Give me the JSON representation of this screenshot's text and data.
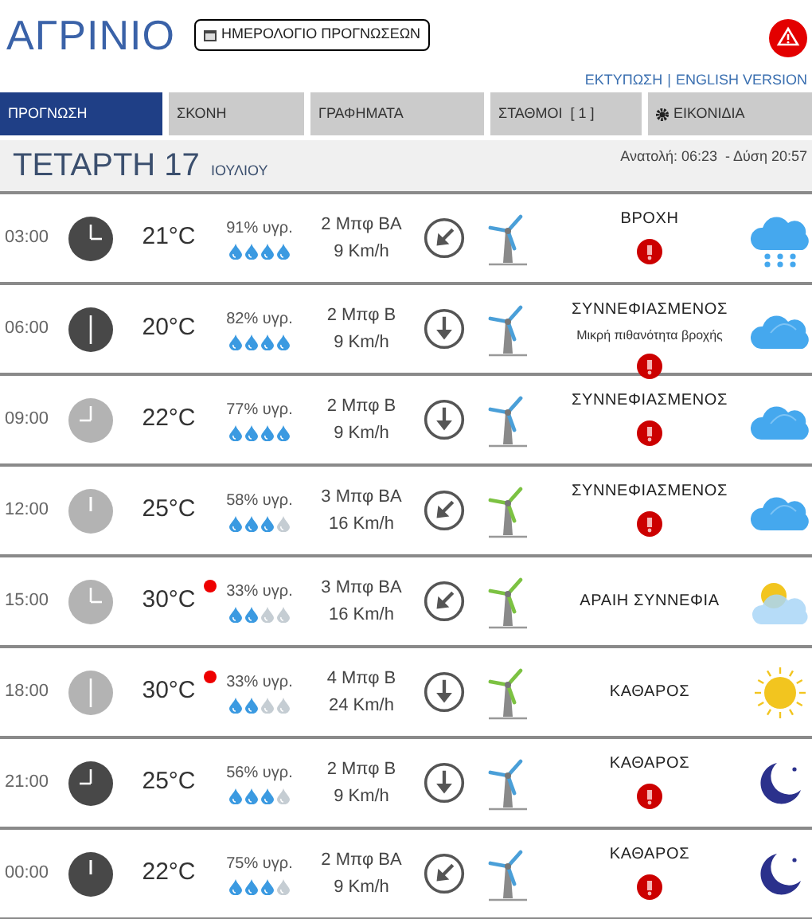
{
  "header": {
    "city": "ΑΓΡΙΝΙΟ",
    "calendar_button": "ΗΜΕΡΟΛΟΓΙΟ ΠΡΟΓΝΩΣΕΩΝ",
    "alert": true,
    "links": [
      "ΕΚΤΥΠΩΣΗ",
      "ENGLISH VERSION"
    ],
    "link_separator": "|"
  },
  "tabs": [
    {
      "label": "ΠΡΟΓΝΩΣΗ",
      "selected": true
    },
    {
      "label": "ΣΚΟΝΗ",
      "selected": false
    },
    {
      "label": "ΓΡΑΦΗΜΑΤΑ",
      "selected": false
    },
    {
      "label": "ΣΤΑΘΜΟΙ  [ 1 ]",
      "selected": false
    },
    {
      "label": "ΕΙΚΟΝΙΔΙΑ",
      "selected": false,
      "kind": "gear"
    }
  ],
  "day": {
    "weekday": "ΤΕΤΑΡΤΗ 17",
    "month": "ΙΟΥΛΙΟΥ",
    "sun": "Ανατολή: 06:23  - Δύση 20:57"
  },
  "rows": [
    {
      "time": "03:00",
      "night": true,
      "temp": "21°C",
      "hot": false,
      "humidity": "91% υγρ.",
      "stars": 4,
      "wind": "2 Μπφ ΒΑ",
      "speed": "9 Km/h",
      "color": "#4a9fd8",
      "desc": "ΒΡΟΧΗ",
      "alert": true,
      "kind": "rain"
    },
    {
      "time": "06:00",
      "night": true,
      "temp": "20°C",
      "hot": false,
      "humidity": "82% υγρ.",
      "stars": 4,
      "wind": "2 Μπφ Β",
      "speed": "9 Km/h",
      "color": "#4a9fd8",
      "desc": "ΣΥΝΝΕΦΙΑΣΜΕΝΟΣ",
      "note": "Μικρή πιθανότητα βροχής",
      "alert": true,
      "kind": "cloud"
    },
    {
      "time": "09:00",
      "night": false,
      "temp": "22°C",
      "hot": false,
      "humidity": "77% υγρ.",
      "stars": 4,
      "wind": "2 Μπφ Β",
      "speed": "9 Km/h",
      "color": "#4a9fd8",
      "desc": "ΣΥΝΝΕΦΙΑΣΜΕΝΟΣ",
      "alert": true,
      "kind": "cloud"
    },
    {
      "time": "12:00",
      "night": false,
      "temp": "25°C",
      "hot": false,
      "humidity": "58% υγρ.",
      "stars": 3,
      "wind": "3 Μπφ ΒΑ",
      "speed": "16 Km/h",
      "color": "#7cc242",
      "desc": "ΣΥΝΝΕΦΙΑΣΜΕΝΟΣ",
      "alert": true,
      "kind": "cloud"
    },
    {
      "time": "15:00",
      "night": false,
      "temp": "30°C",
      "hot": true,
      "humidity": "33% υγρ.",
      "stars": 2,
      "wind": "3 Μπφ ΒΑ",
      "speed": "16 Km/h",
      "color": "#7cc242",
      "desc": "ΑΡΑΙΗ ΣΥΝΝΕΦΙΑ",
      "alert": false,
      "kind": "partly"
    },
    {
      "time": "18:00",
      "night": false,
      "temp": "30°C",
      "hot": true,
      "humidity": "33% υγρ.",
      "stars": 2,
      "wind": "4 Μπφ Β",
      "speed": "24 Km/h",
      "color": "#7cc242",
      "desc": "ΚΑΘΑΡΟΣ",
      "alert": false,
      "kind": "sun"
    },
    {
      "time": "21:00",
      "night": true,
      "temp": "25°C",
      "hot": false,
      "humidity": "56% υγρ.",
      "stars": 3,
      "wind": "2 Μπφ Β",
      "speed": "9 Km/h",
      "color": "#4a9fd8",
      "desc": "ΚΑΘΑΡΟΣ",
      "alert": true,
      "kind": "moon"
    },
    {
      "time": "00:00",
      "night": true,
      "temp": "22°C",
      "hot": false,
      "humidity": "75% υγρ.",
      "stars": 3,
      "wind": "2 Μπφ ΒΑ",
      "speed": "9 Km/h",
      "color": "#4a9fd8",
      "desc": "ΚΑΘΑΡΟΣ",
      "alert": true,
      "kind": "moon"
    }
  ]
}
